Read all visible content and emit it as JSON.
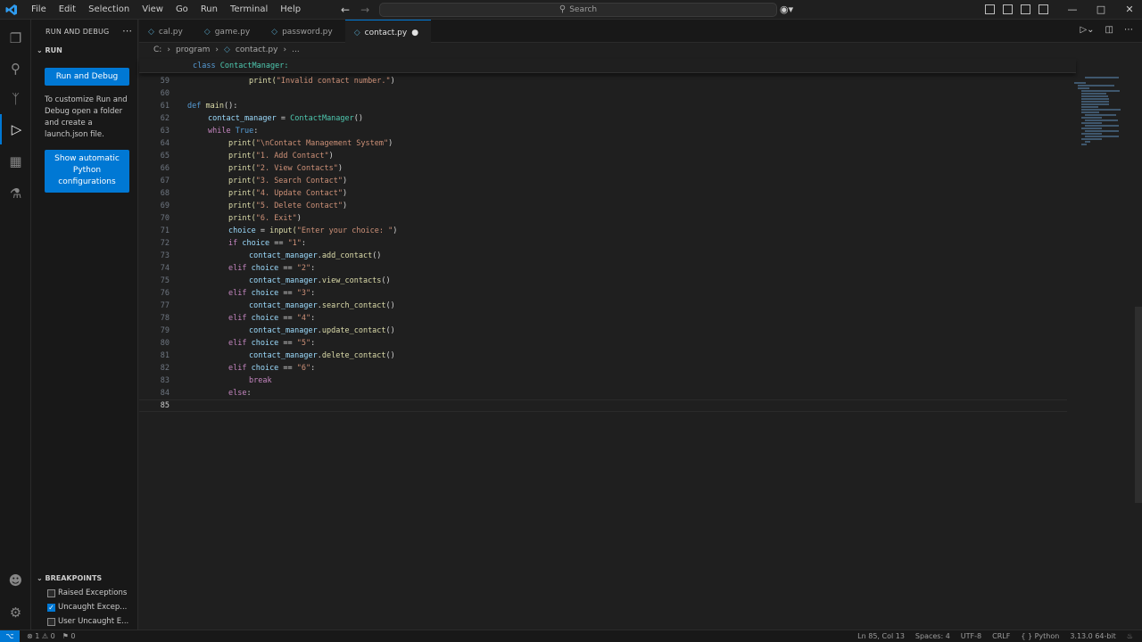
{
  "menu": [
    "File",
    "Edit",
    "Selection",
    "View",
    "Go",
    "Run",
    "Terminal",
    "Help"
  ],
  "search": {
    "label": "Search"
  },
  "sidebar": {
    "title": "RUN AND DEBUG",
    "section": "RUN",
    "run_button": "Run and Debug",
    "customize_text": "To customize Run and Debug open a folder and create a launch.json file.",
    "show_button": "Show automatic Python configurations",
    "breakpoints_title": "BREAKPOINTS",
    "breakpoints": [
      {
        "label": "Raised Exceptions",
        "checked": false
      },
      {
        "label": "Uncaught Excep...",
        "checked": true
      },
      {
        "label": "User Uncaught E...",
        "checked": false
      }
    ]
  },
  "tabs": [
    {
      "label": "cal.py",
      "active": false,
      "dirty": false
    },
    {
      "label": "game.py",
      "active": false,
      "dirty": false
    },
    {
      "label": "password.py",
      "active": false,
      "dirty": false
    },
    {
      "label": "contact.py",
      "active": true,
      "dirty": true
    }
  ],
  "breadcrumb": {
    "root": "C:",
    "folder": "program",
    "file": "contact.py",
    "more": "..."
  },
  "sticky": {
    "keyword": "class",
    "name": "ContactManager:"
  },
  "code": [
    {
      "n": "59",
      "indent": 3,
      "segs": [
        [
          "print(",
          "#dcdcaa"
        ],
        [
          "\"Invalid contact number.\"",
          "#ce9178"
        ],
        [
          ")",
          "#d4d4d4"
        ]
      ]
    },
    {
      "n": "60",
      "indent": 0,
      "segs": []
    },
    {
      "n": "61",
      "indent": 0,
      "segs": [
        [
          "def ",
          "#569cd6"
        ],
        [
          "main",
          "#dcdcaa"
        ],
        [
          "():",
          "#d4d4d4"
        ]
      ]
    },
    {
      "n": "62",
      "indent": 1,
      "segs": [
        [
          "contact_manager",
          "#9cdcfe"
        ],
        [
          " = ",
          "#d4d4d4"
        ],
        [
          "ContactManager",
          "#4ec9b0"
        ],
        [
          "()",
          "#d4d4d4"
        ]
      ]
    },
    {
      "n": "63",
      "indent": 1,
      "segs": [
        [
          "while ",
          "#c586c0"
        ],
        [
          "True",
          "#569cd6"
        ],
        [
          ":",
          "#d4d4d4"
        ]
      ]
    },
    {
      "n": "64",
      "indent": 2,
      "segs": [
        [
          "print(",
          "#dcdcaa"
        ],
        [
          "\"\\nContact Management System\"",
          "#ce9178"
        ],
        [
          ")",
          "#d4d4d4"
        ]
      ]
    },
    {
      "n": "65",
      "indent": 2,
      "segs": [
        [
          "print(",
          "#dcdcaa"
        ],
        [
          "\"1. Add Contact\"",
          "#ce9178"
        ],
        [
          ")",
          "#d4d4d4"
        ]
      ]
    },
    {
      "n": "66",
      "indent": 2,
      "segs": [
        [
          "print(",
          "#dcdcaa"
        ],
        [
          "\"2. View Contacts\"",
          "#ce9178"
        ],
        [
          ")",
          "#d4d4d4"
        ]
      ]
    },
    {
      "n": "67",
      "indent": 2,
      "segs": [
        [
          "print(",
          "#dcdcaa"
        ],
        [
          "\"3. Search Contact\"",
          "#ce9178"
        ],
        [
          ")",
          "#d4d4d4"
        ]
      ]
    },
    {
      "n": "68",
      "indent": 2,
      "segs": [
        [
          "print(",
          "#dcdcaa"
        ],
        [
          "\"4. Update Contact\"",
          "#ce9178"
        ],
        [
          ")",
          "#d4d4d4"
        ]
      ]
    },
    {
      "n": "69",
      "indent": 2,
      "segs": [
        [
          "print(",
          "#dcdcaa"
        ],
        [
          "\"5. Delete Contact\"",
          "#ce9178"
        ],
        [
          ")",
          "#d4d4d4"
        ]
      ]
    },
    {
      "n": "70",
      "indent": 2,
      "segs": [
        [
          "print(",
          "#dcdcaa"
        ],
        [
          "\"6. Exit\"",
          "#ce9178"
        ],
        [
          ")",
          "#d4d4d4"
        ]
      ]
    },
    {
      "n": "71",
      "indent": 2,
      "segs": [
        [
          "choice",
          "#9cdcfe"
        ],
        [
          " = ",
          "#d4d4d4"
        ],
        [
          "input(",
          "#dcdcaa"
        ],
        [
          "\"Enter your choice: \"",
          "#ce9178"
        ],
        [
          ")",
          "#d4d4d4"
        ]
      ]
    },
    {
      "n": "72",
      "indent": 2,
      "segs": [
        [
          "if ",
          "#c586c0"
        ],
        [
          "choice",
          "#9cdcfe"
        ],
        [
          " == ",
          "#d4d4d4"
        ],
        [
          "\"1\"",
          "#ce9178"
        ],
        [
          ":",
          "#d4d4d4"
        ]
      ]
    },
    {
      "n": "73",
      "indent": 3,
      "segs": [
        [
          "contact_manager",
          "#9cdcfe"
        ],
        [
          ".",
          "#d4d4d4"
        ],
        [
          "add_contact",
          "#dcdcaa"
        ],
        [
          "()",
          "#d4d4d4"
        ]
      ]
    },
    {
      "n": "74",
      "indent": 2,
      "segs": [
        [
          "elif ",
          "#c586c0"
        ],
        [
          "choice",
          "#9cdcfe"
        ],
        [
          " == ",
          "#d4d4d4"
        ],
        [
          "\"2\"",
          "#ce9178"
        ],
        [
          ":",
          "#d4d4d4"
        ]
      ]
    },
    {
      "n": "75",
      "indent": 3,
      "segs": [
        [
          "contact_manager",
          "#9cdcfe"
        ],
        [
          ".",
          "#d4d4d4"
        ],
        [
          "view_contacts",
          "#dcdcaa"
        ],
        [
          "()",
          "#d4d4d4"
        ]
      ]
    },
    {
      "n": "76",
      "indent": 2,
      "segs": [
        [
          "elif ",
          "#c586c0"
        ],
        [
          "choice",
          "#9cdcfe"
        ],
        [
          " == ",
          "#d4d4d4"
        ],
        [
          "\"3\"",
          "#ce9178"
        ],
        [
          ":",
          "#d4d4d4"
        ]
      ]
    },
    {
      "n": "77",
      "indent": 3,
      "segs": [
        [
          "contact_manager",
          "#9cdcfe"
        ],
        [
          ".",
          "#d4d4d4"
        ],
        [
          "search_contact",
          "#dcdcaa"
        ],
        [
          "()",
          "#d4d4d4"
        ]
      ]
    },
    {
      "n": "78",
      "indent": 2,
      "segs": [
        [
          "elif ",
          "#c586c0"
        ],
        [
          "choice",
          "#9cdcfe"
        ],
        [
          " == ",
          "#d4d4d4"
        ],
        [
          "\"4\"",
          "#ce9178"
        ],
        [
          ":",
          "#d4d4d4"
        ]
      ]
    },
    {
      "n": "79",
      "indent": 3,
      "segs": [
        [
          "contact_manager",
          "#9cdcfe"
        ],
        [
          ".",
          "#d4d4d4"
        ],
        [
          "update_contact",
          "#dcdcaa"
        ],
        [
          "()",
          "#d4d4d4"
        ]
      ]
    },
    {
      "n": "80",
      "indent": 2,
      "segs": [
        [
          "elif ",
          "#c586c0"
        ],
        [
          "choice",
          "#9cdcfe"
        ],
        [
          " == ",
          "#d4d4d4"
        ],
        [
          "\"5\"",
          "#ce9178"
        ],
        [
          ":",
          "#d4d4d4"
        ]
      ]
    },
    {
      "n": "81",
      "indent": 3,
      "segs": [
        [
          "contact_manager",
          "#9cdcfe"
        ],
        [
          ".",
          "#d4d4d4"
        ],
        [
          "delete_contact",
          "#dcdcaa"
        ],
        [
          "()",
          "#d4d4d4"
        ]
      ]
    },
    {
      "n": "82",
      "indent": 2,
      "segs": [
        [
          "elif ",
          "#c586c0"
        ],
        [
          "choice",
          "#9cdcfe"
        ],
        [
          " == ",
          "#d4d4d4"
        ],
        [
          "\"6\"",
          "#ce9178"
        ],
        [
          ":",
          "#d4d4d4"
        ]
      ]
    },
    {
      "n": "83",
      "indent": 3,
      "segs": [
        [
          "break",
          "#c586c0"
        ]
      ]
    },
    {
      "n": "84",
      "indent": 2,
      "segs": [
        [
          "else",
          "#c586c0"
        ],
        [
          ":",
          "#d4d4d4"
        ]
      ]
    },
    {
      "n": "85",
      "indent": 3,
      "segs": []
    }
  ],
  "status": {
    "remote": "⌥",
    "problems": "⊗ 1 ⚠ 0",
    "ports": "⚑ 0",
    "position": "Ln 85, Col 13",
    "spaces": "Spaces: 4",
    "encoding": "UTF-8",
    "eol": "CRLF",
    "language": "{ } Python",
    "interpreter": "3.13.0 64-bit"
  },
  "colors": {
    "accent": "#0078d4",
    "background": "#1f1f1f",
    "sidebar": "#181818"
  }
}
